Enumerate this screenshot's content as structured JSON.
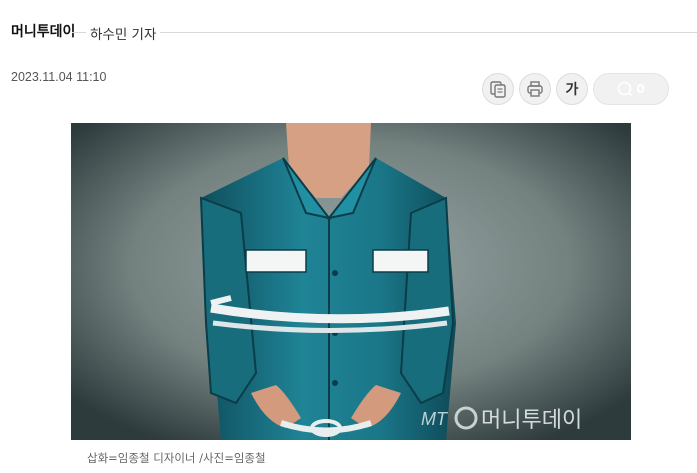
{
  "article": {
    "press_name": "머니투데이",
    "reporter": "하수민 기자",
    "date": "2023.11.04 11:10"
  },
  "toolbar": {
    "copy_icon": "copy-icon",
    "print_icon": "print-icon",
    "font_label": "가",
    "comment_count": "0"
  },
  "image": {
    "watermark_mt": "MT",
    "watermark_name": "머니투데이",
    "caption": "삽화=임종철 디자이너 /사진=임종철"
  },
  "colors": {
    "wall": "#5f6d6e",
    "uniform": "#1d7c8d",
    "rope": "#e9eef0",
    "skin": "#d9a184"
  }
}
